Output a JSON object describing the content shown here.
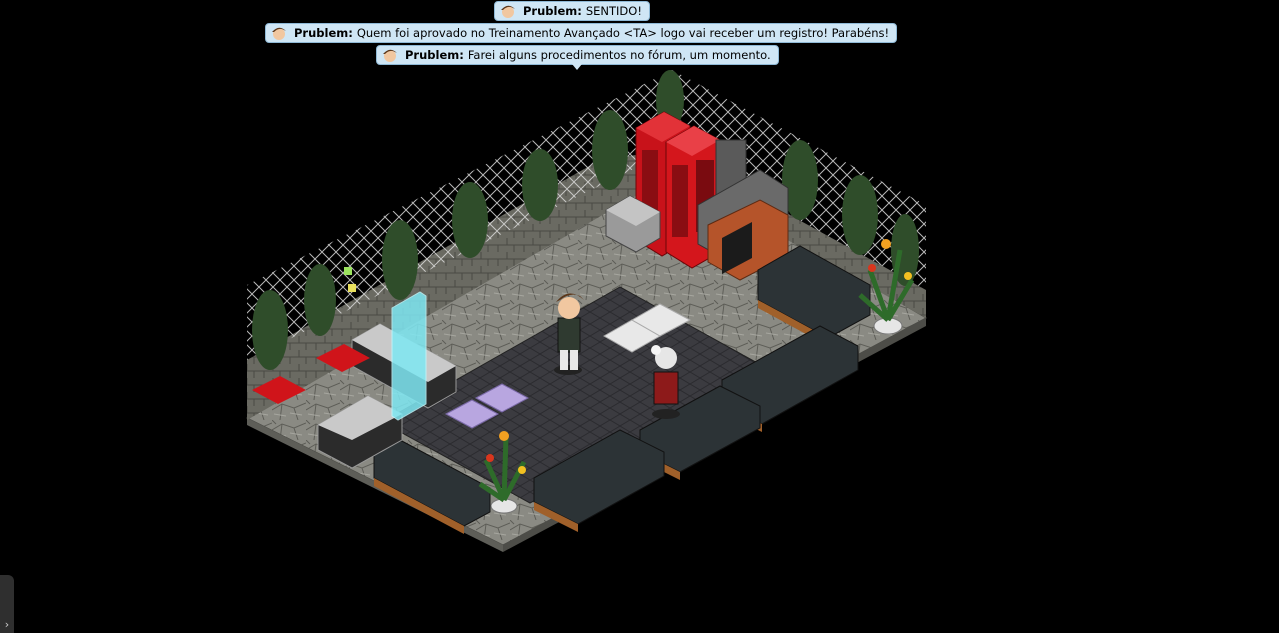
{
  "chat": {
    "messages": [
      {
        "user": "Prublem:",
        "text": "SENTIDO!"
      },
      {
        "user": "Prublem:",
        "text": "Quem foi aprovado no Treinamento Avançado <TA> logo vai receber um registro! Parabéns!"
      },
      {
        "user": "Prublem:",
        "text": "Farei alguns procedimentos no fórum, um momento."
      }
    ]
  },
  "colors": {
    "background": "#000000",
    "bubble": "#cfe6f5",
    "phone_booth": "#d4161c",
    "floor_stone": "#8b8b84",
    "floor_tile": "#3a3a3e",
    "sofa": "#2c3336"
  },
  "icons": {
    "avatar": "avatar-head-icon",
    "panel_toggle": "chevron-right-icon"
  },
  "panel_toggle": {
    "glyph": "›"
  }
}
